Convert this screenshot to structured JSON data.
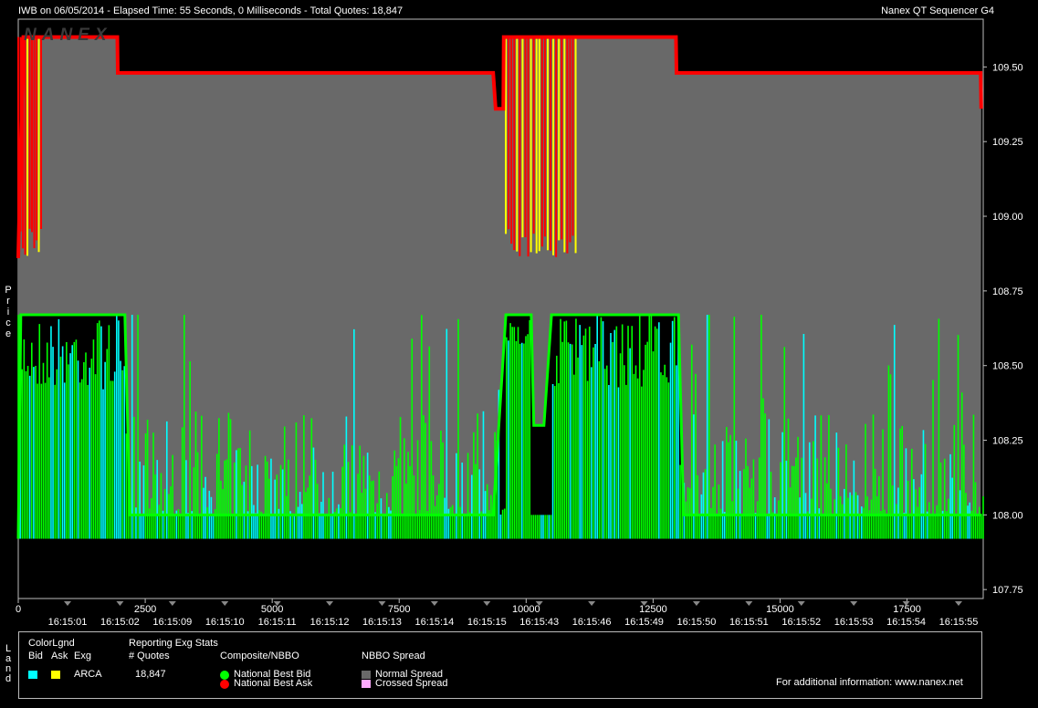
{
  "header": {
    "title_left": "IWB on 06/05/2014  -  Elapsed Time: 55 Seconds, 0 Milliseconds  -  Total Quotes: 18,847",
    "title_right": "Nanex QT Sequencer G4",
    "watermark": "NANEX"
  },
  "axis_labels": {
    "y_vertical": [
      "P",
      "r",
      "i",
      "c",
      "e"
    ],
    "land_vertical": [
      "L",
      "a",
      "n",
      "d"
    ]
  },
  "chart_data": {
    "type": "line",
    "title": "IWB on 06/05/2014",
    "xlabel": "",
    "ylabel": "Price",
    "x_range": [
      0,
      19000
    ],
    "ylim": [
      107.72,
      109.66
    ],
    "y_ticks": [
      "109.50",
      "109.25",
      "109.00",
      "108.75",
      "108.50",
      "108.25",
      "108.00",
      "107.75"
    ],
    "x_ticks": [
      "0",
      "2500",
      "5000",
      "7500",
      "10000",
      "12500",
      "15000",
      "17500"
    ],
    "time_labels": [
      "16:15:01",
      "16:15:02",
      "16:15:09",
      "16:15:10",
      "16:15:11",
      "16:15:12",
      "16:15:13",
      "16:15:14",
      "16:15:15",
      "16:15:43",
      "16:15:46",
      "16:15:49",
      "16:15:50",
      "16:15:51",
      "16:15:52",
      "16:15:53",
      "16:15:54",
      "16:15:55"
    ],
    "grid": false,
    "series": [
      {
        "name": "National Best Ask",
        "color": "#ff0000",
        "points": [
          [
            0,
            108.86
          ],
          [
            100,
            109.6
          ],
          [
            500,
            109.6
          ],
          [
            1950,
            109.6
          ],
          [
            1960,
            109.48
          ],
          [
            9350,
            109.48
          ],
          [
            9400,
            109.36
          ],
          [
            9550,
            109.36
          ],
          [
            9560,
            109.6
          ],
          [
            11000,
            109.6
          ],
          [
            11050,
            109.6
          ],
          [
            12950,
            109.6
          ],
          [
            12960,
            109.48
          ],
          [
            18950,
            109.48
          ],
          [
            18960,
            109.36
          ]
        ]
      },
      {
        "name": "National Best Bid",
        "color": "#00ff00",
        "points": [
          [
            0,
            107.92
          ],
          [
            50,
            108.67
          ],
          [
            2100,
            108.67
          ],
          [
            2200,
            108.0
          ],
          [
            9350,
            108.0
          ],
          [
            9600,
            108.67
          ],
          [
            10100,
            108.67
          ],
          [
            10150,
            108.3
          ],
          [
            10350,
            108.3
          ],
          [
            10500,
            108.67
          ],
          [
            13000,
            108.67
          ],
          [
            13100,
            108.0
          ],
          [
            18950,
            108.0
          ]
        ]
      }
    ],
    "legend_placement": "bottom",
    "colors": {
      "ask": "#ff0000",
      "bid": "#00ff00",
      "arca_bid": "#00ffff",
      "arca_ask": "#ffff00",
      "normal_spread": "#696969",
      "crossed_spread": "#ffaaff"
    }
  },
  "legend": {
    "color_legend_title": "ColorLgnd",
    "bid_label": "Bid",
    "ask_label": "Ask",
    "exg_label": "Exg",
    "exchange": "ARCA",
    "stats_title": "Reporting Exg Stats",
    "quotes_label": "# Quotes",
    "quotes_value": "18,847",
    "composite_title": "Composite/NBBO",
    "nbb_label": "National Best Bid",
    "nbo_label": "National Best Ask",
    "spread_title": "NBBO Spread",
    "normal_spread_label": "Normal Spread",
    "crossed_spread_label": "Crossed Spread",
    "info": "For additional information: www.nanex.net"
  }
}
